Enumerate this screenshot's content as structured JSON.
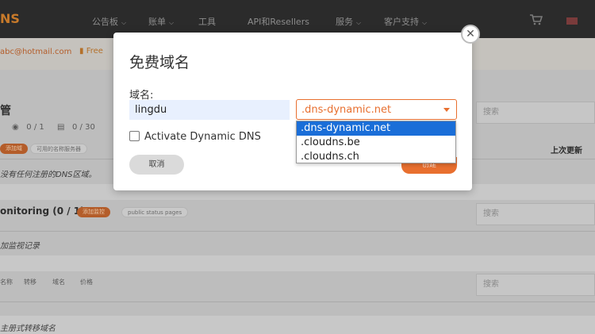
{
  "header": {
    "logo": "NS",
    "nav": [
      {
        "label": "公告板",
        "chevron": true
      },
      {
        "label": "账单",
        "chevron": true
      },
      {
        "label": "工具",
        "chevron": false
      },
      {
        "label": "API和Resellers",
        "chevron": false
      },
      {
        "label": "服务",
        "chevron": true
      },
      {
        "label": "客户支持",
        "chevron": true
      }
    ]
  },
  "subbar": {
    "email": "abc@hotmail.com",
    "plan": "Free"
  },
  "background": {
    "section_title": "管",
    "stat1": "0 / 1",
    "stat2": "0 / 30",
    "pill_orange1": "添加域",
    "pill_grey1": "可用的名称服务器",
    "no_zones": "没有任何注册的DNS区域。",
    "last_updated": "上次更新",
    "monitoring_title": "onitoring (0 / 1)",
    "pill_orange2": "添加监控",
    "pill_grey2": "public status pages",
    "no_monitors": "加监视记录",
    "filters": [
      "名称",
      "转移",
      "域名",
      "价格"
    ],
    "bottom_text": "主册式转移域名",
    "search_placeholder": "搜索"
  },
  "modal": {
    "title": "免费域名",
    "domain_label": "域名:",
    "domain_value": "lingdu",
    "selected_suffix": ".dns-dynamic.net",
    "options": [
      ".dns-dynamic.net",
      ".cloudns.be",
      ".cloudns.ch"
    ],
    "dynamic_dns_label": "Activate Dynamic DNS",
    "dynamic_dns_checked": false,
    "cancel_label": "取消",
    "create_label": "创建"
  },
  "colors": {
    "accent": "#e86f2f",
    "selected_option": "#1a6ed8"
  }
}
